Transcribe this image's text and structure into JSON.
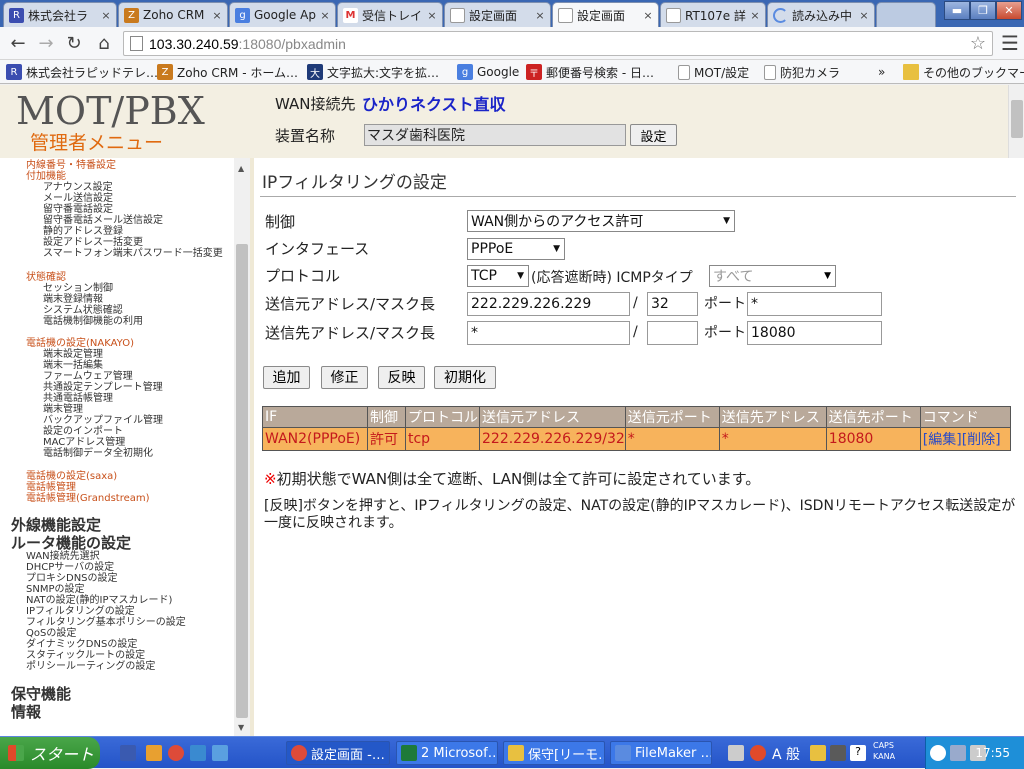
{
  "browser": {
    "tabs": [
      {
        "label": "株式会社ラ",
        "icon": "rapid-icon",
        "color": "#3b4db0"
      },
      {
        "label": "Zoho CRM",
        "icon": "zoho-icon",
        "color": "#c97a1e"
      },
      {
        "label": "Google Ap",
        "icon": "google-icon",
        "color": "#4a7fe0"
      },
      {
        "label": "受信トレイ",
        "icon": "gmail-icon",
        "color": "#d33"
      },
      {
        "label": "設定画面",
        "icon": "page-icon",
        "color": "#999"
      },
      {
        "label": "設定画面",
        "icon": "page-icon",
        "color": "#999"
      },
      {
        "label": "RT107e 詳",
        "icon": "page-icon",
        "color": "#999"
      },
      {
        "label": "読み込み中",
        "icon": "loading-icon",
        "color": "#5a8be0"
      }
    ],
    "close_glyph": "×",
    "url_host": "103.30.240.59",
    "url_path": ":18080/pbxadmin",
    "bookmarks": [
      {
        "label": "株式会社ラピッドテレ…",
        "icon": "rapid-icon",
        "color": "#3b4db0"
      },
      {
        "label": "Zoho CRM - ホーム…",
        "icon": "zoho-icon",
        "color": "#c97a1e"
      },
      {
        "label": "文字拡大:文字を拡…",
        "icon": "kakudai-icon",
        "color": "#1e3a78"
      },
      {
        "label": "Google",
        "icon": "google-icon",
        "color": "#4a7fe0"
      },
      {
        "label": "郵便番号検索 - 日…",
        "icon": "post-icon",
        "color": "#c22"
      },
      {
        "label": "MOT/設定",
        "icon": "page-icon",
        "color": "#fff"
      },
      {
        "label": "防犯カメラ",
        "icon": "page-icon",
        "color": "#fff"
      }
    ],
    "bookmarks_more": "»",
    "other_bookmarks": "その他のブックマーク"
  },
  "header": {
    "logo": "MOT/PBX",
    "logo_sub": "管理者メニュー",
    "wan_label": "WAN接続先",
    "wan_value": "ひかりネクスト直収",
    "device_label": "装置名称",
    "device_value": "マスダ歯科医院",
    "device_button": "設定"
  },
  "sidebar": {
    "groups": [
      {
        "head": "内線番号・特番設定",
        "items": []
      },
      {
        "head": "付加機能",
        "items": [
          "アナウンス設定",
          "メール送信設定",
          "留守番電話設定",
          "留守番電話メール送信設定",
          "静的アドレス登録",
          "設定アドレス一括変更",
          "スマートフォン端末パスワード一括変更"
        ]
      },
      {
        "head": "状態確認",
        "items": [
          "セッション制御",
          "端末登録情報",
          "システム状態確認",
          "電話機制御機能の利用"
        ]
      },
      {
        "head": "電話機の設定(NAKAYO)",
        "items": [
          "端末設定管理",
          "端末一括編集",
          "ファームウェア管理",
          "共通設定テンプレート管理",
          "共通電話帳管理",
          "端末管理",
          "バックアップファイル管理",
          "設定のインポート",
          "MACアドレス管理",
          "電話制御データ全初期化"
        ]
      },
      {
        "head": "電話機の設定(saxa)",
        "items": []
      },
      {
        "head": "電話帳管理",
        "items": []
      },
      {
        "head": "電話帳管理(Grandstream)",
        "items": []
      }
    ],
    "section_outer": "外線機能設定",
    "section_router": "ルータ機能の設定",
    "router_items": [
      "WAN接続先選択",
      "DHCPサーバの設定",
      "プロキシDNSの設定",
      "SNMPの設定",
      "NATの設定(静的IPマスカレード)",
      "IPフィルタリングの設定",
      "フィルタリング基本ポリシーの設定",
      "QoSの設定",
      "ダイナミックDNSの設定",
      "スタティックルートの設定",
      "ポリシールーティングの設定"
    ],
    "section_maint": "保守機能",
    "section_info": "情報"
  },
  "form": {
    "title": "IPフィルタリングの設定",
    "control_label": "制御",
    "control_value": "WAN側からのアクセス許可",
    "interface_label": "インタフェース",
    "interface_value": "PPPoE",
    "protocol_label": "プロトコル",
    "protocol_value": "TCP",
    "protocol_suffix": "(応答遮断時) ICMPタイプ",
    "icmp_value": "すべて",
    "src_label": "送信元アドレス/マスク長",
    "src_addr": "222.229.226.229",
    "src_mask": "32",
    "dst_label": "送信先アドレス/マスク長",
    "dst_addr": "*",
    "dst_mask": "",
    "slash": "/",
    "port_label": "ポート",
    "src_port": "*",
    "dst_port": "18080",
    "add_button": "追加",
    "modify_button": "修正",
    "apply_button": "反映",
    "init_button": "初期化",
    "arrow": "▼"
  },
  "rules_table": {
    "headers": [
      "IF",
      "制御",
      "プロトコル",
      "送信元アドレス",
      "送信元ポート",
      "送信先アドレス",
      "送信先ポート",
      "コマンド"
    ],
    "rows": [
      {
        "if": "WAN2(PPPoE)",
        "ctrl": "許可",
        "proto": "tcp",
        "src": "222.229.226.229/32",
        "sport": "*",
        "dst": "*",
        "dport": "18080",
        "edit": "[編集]",
        "del": "[削除]"
      }
    ]
  },
  "notes": {
    "mark": "※",
    "note1": "初期状態でWAN側は全て遮断、LAN側は全て許可に設定されています。",
    "note2": "[反映]ボタンを押すと、IPフィルタリングの設定、NATの設定(静的IPマスカレード)、ISDNリモートアクセス転送設定が一度に反映されます。"
  },
  "taskbar": {
    "start": "スタート",
    "items": [
      {
        "label": "設定画面 -…",
        "color": "#dd4b39"
      },
      {
        "label": "2 Microsof…",
        "color": "#1e7a3a"
      },
      {
        "label": "保守[リーモ…",
        "color": "#e8c040"
      },
      {
        "label": "FileMaker …",
        "color": "#5a8be0"
      }
    ],
    "ime": "A 般",
    "caps": "CAPS",
    "kana": "KANA",
    "clock": "17:55"
  }
}
